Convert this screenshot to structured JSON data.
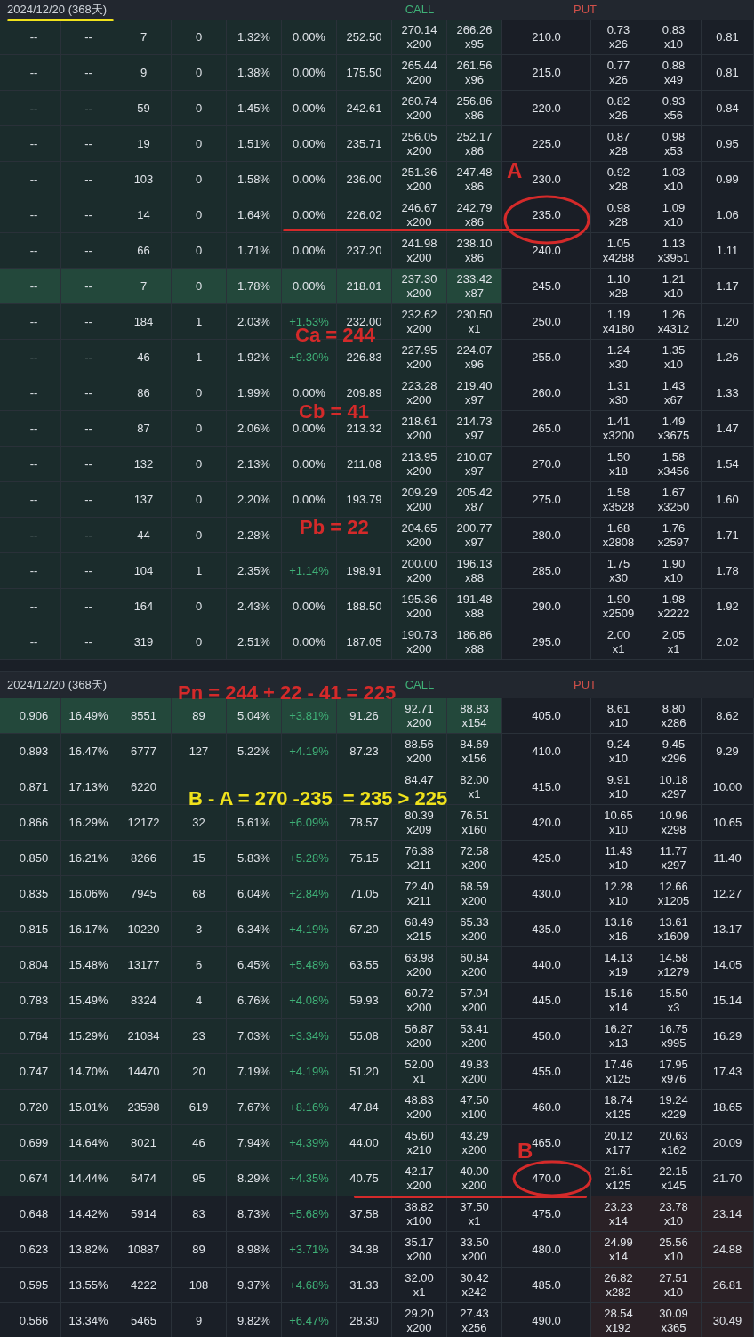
{
  "panels": [
    {
      "header": {
        "date": "2024/12/20 (368天)",
        "call_label": "CALL",
        "put_label": "PUT"
      },
      "rows": [
        {
          "strike": "210.0",
          "call": [
            "--",
            "--",
            "7",
            "0",
            "1.32%",
            "0.00%",
            "252.50"
          ],
          "change_up": false,
          "call_quotes": [
            [
              "270.14",
              "x200"
            ],
            [
              "266.26",
              "x95"
            ]
          ],
          "put_quotes": [
            [
              "0.73",
              "x26"
            ],
            [
              "0.83",
              "x10"
            ]
          ],
          "put_last": "0.81",
          "call_itm": true,
          "put_itm": false,
          "highlighted": false
        },
        {
          "strike": "215.0",
          "call": [
            "--",
            "--",
            "9",
            "0",
            "1.38%",
            "0.00%",
            "175.50"
          ],
          "change_up": false,
          "call_quotes": [
            [
              "265.44",
              "x200"
            ],
            [
              "261.56",
              "x96"
            ]
          ],
          "put_quotes": [
            [
              "0.77",
              "x26"
            ],
            [
              "0.88",
              "x49"
            ]
          ],
          "put_last": "0.81",
          "call_itm": true,
          "put_itm": false,
          "highlighted": false
        },
        {
          "strike": "220.0",
          "call": [
            "--",
            "--",
            "59",
            "0",
            "1.45%",
            "0.00%",
            "242.61"
          ],
          "change_up": false,
          "call_quotes": [
            [
              "260.74",
              "x200"
            ],
            [
              "256.86",
              "x86"
            ]
          ],
          "put_quotes": [
            [
              "0.82",
              "x26"
            ],
            [
              "0.93",
              "x56"
            ]
          ],
          "put_last": "0.84",
          "call_itm": true,
          "put_itm": false,
          "highlighted": false
        },
        {
          "strike": "225.0",
          "call": [
            "--",
            "--",
            "19",
            "0",
            "1.51%",
            "0.00%",
            "235.71"
          ],
          "change_up": false,
          "call_quotes": [
            [
              "256.05",
              "x200"
            ],
            [
              "252.17",
              "x86"
            ]
          ],
          "put_quotes": [
            [
              "0.87",
              "x28"
            ],
            [
              "0.98",
              "x53"
            ]
          ],
          "put_last": "0.95",
          "call_itm": true,
          "put_itm": false,
          "highlighted": false
        },
        {
          "strike": "230.0",
          "call": [
            "--",
            "--",
            "103",
            "0",
            "1.58%",
            "0.00%",
            "236.00"
          ],
          "change_up": false,
          "call_quotes": [
            [
              "251.36",
              "x200"
            ],
            [
              "247.48",
              "x86"
            ]
          ],
          "put_quotes": [
            [
              "0.92",
              "x28"
            ],
            [
              "1.03",
              "x10"
            ]
          ],
          "put_last": "0.99",
          "call_itm": true,
          "put_itm": false,
          "highlighted": false
        },
        {
          "strike": "235.0",
          "call": [
            "--",
            "--",
            "14",
            "0",
            "1.64%",
            "0.00%",
            "226.02"
          ],
          "change_up": false,
          "call_quotes": [
            [
              "246.67",
              "x200"
            ],
            [
              "242.79",
              "x86"
            ]
          ],
          "put_quotes": [
            [
              "0.98",
              "x28"
            ],
            [
              "1.09",
              "x10"
            ]
          ],
          "put_last": "1.06",
          "call_itm": true,
          "put_itm": false,
          "highlighted": false
        },
        {
          "strike": "240.0",
          "call": [
            "--",
            "--",
            "66",
            "0",
            "1.71%",
            "0.00%",
            "237.20"
          ],
          "change_up": false,
          "call_quotes": [
            [
              "241.98",
              "x200"
            ],
            [
              "238.10",
              "x86"
            ]
          ],
          "put_quotes": [
            [
              "1.05",
              "x4288"
            ],
            [
              "1.13",
              "x3951"
            ]
          ],
          "put_last": "1.11",
          "call_itm": true,
          "put_itm": false,
          "highlighted": false
        },
        {
          "strike": "245.0",
          "call": [
            "--",
            "--",
            "7",
            "0",
            "1.78%",
            "0.00%",
            "218.01"
          ],
          "change_up": false,
          "call_quotes": [
            [
              "237.30",
              "x200"
            ],
            [
              "233.42",
              "x87"
            ]
          ],
          "put_quotes": [
            [
              "1.10",
              "x28"
            ],
            [
              "1.21",
              "x10"
            ]
          ],
          "put_last": "1.17",
          "call_itm": true,
          "put_itm": false,
          "highlighted": true
        },
        {
          "strike": "250.0",
          "call": [
            "--",
            "--",
            "184",
            "1",
            "2.03%",
            "+1.53%",
            "232.00"
          ],
          "change_up": true,
          "call_quotes": [
            [
              "232.62",
              "x200"
            ],
            [
              "230.50",
              "x1"
            ]
          ],
          "put_quotes": [
            [
              "1.19",
              "x4180"
            ],
            [
              "1.26",
              "x4312"
            ]
          ],
          "put_last": "1.20",
          "call_itm": true,
          "put_itm": false,
          "highlighted": false
        },
        {
          "strike": "255.0",
          "call": [
            "--",
            "--",
            "46",
            "1",
            "1.92%",
            "+9.30%",
            "226.83"
          ],
          "change_up": true,
          "call_quotes": [
            [
              "227.95",
              "x200"
            ],
            [
              "224.07",
              "x96"
            ]
          ],
          "put_quotes": [
            [
              "1.24",
              "x30"
            ],
            [
              "1.35",
              "x10"
            ]
          ],
          "put_last": "1.26",
          "call_itm": true,
          "put_itm": false,
          "highlighted": false
        },
        {
          "strike": "260.0",
          "call": [
            "--",
            "--",
            "86",
            "0",
            "1.99%",
            "0.00%",
            "209.89"
          ],
          "change_up": false,
          "call_quotes": [
            [
              "223.28",
              "x200"
            ],
            [
              "219.40",
              "x97"
            ]
          ],
          "put_quotes": [
            [
              "1.31",
              "x30"
            ],
            [
              "1.43",
              "x67"
            ]
          ],
          "put_last": "1.33",
          "call_itm": true,
          "put_itm": false,
          "highlighted": false
        },
        {
          "strike": "265.0",
          "call": [
            "--",
            "--",
            "87",
            "0",
            "2.06%",
            "0.00%",
            "213.32"
          ],
          "change_up": false,
          "call_quotes": [
            [
              "218.61",
              "x200"
            ],
            [
              "214.73",
              "x97"
            ]
          ],
          "put_quotes": [
            [
              "1.41",
              "x3200"
            ],
            [
              "1.49",
              "x3675"
            ]
          ],
          "put_last": "1.47",
          "call_itm": true,
          "put_itm": false,
          "highlighted": false
        },
        {
          "strike": "270.0",
          "call": [
            "--",
            "--",
            "132",
            "0",
            "2.13%",
            "0.00%",
            "211.08"
          ],
          "change_up": false,
          "call_quotes": [
            [
              "213.95",
              "x200"
            ],
            [
              "210.07",
              "x97"
            ]
          ],
          "put_quotes": [
            [
              "1.50",
              "x18"
            ],
            [
              "1.58",
              "x3456"
            ]
          ],
          "put_last": "1.54",
          "call_itm": true,
          "put_itm": false,
          "highlighted": false
        },
        {
          "strike": "275.0",
          "call": [
            "--",
            "--",
            "137",
            "0",
            "2.20%",
            "0.00%",
            "193.79"
          ],
          "change_up": false,
          "call_quotes": [
            [
              "209.29",
              "x200"
            ],
            [
              "205.42",
              "x87"
            ]
          ],
          "put_quotes": [
            [
              "1.58",
              "x3528"
            ],
            [
              "1.67",
              "x3250"
            ]
          ],
          "put_last": "1.60",
          "call_itm": true,
          "put_itm": false,
          "highlighted": false
        },
        {
          "strike": "280.0",
          "call": [
            "--",
            "--",
            "44",
            "0",
            "2.28%"
          ],
          "call_quotes": [
            [
              "204.65",
              "x200"
            ],
            [
              "200.77",
              "x97"
            ]
          ],
          "put_quotes": [
            [
              "1.68",
              "x2808"
            ],
            [
              "1.76",
              "x2597"
            ]
          ],
          "put_last": "1.71",
          "call_itm": true,
          "put_itm": false,
          "highlighted": false
        },
        {
          "strike": "285.0",
          "call": [
            "--",
            "--",
            "104",
            "1",
            "2.35%",
            "+1.14%",
            "198.91"
          ],
          "change_up": true,
          "call_quotes": [
            [
              "200.00",
              "x200"
            ],
            [
              "196.13",
              "x88"
            ]
          ],
          "put_quotes": [
            [
              "1.75",
              "x30"
            ],
            [
              "1.90",
              "x10"
            ]
          ],
          "put_last": "1.78",
          "call_itm": true,
          "put_itm": false,
          "highlighted": false
        },
        {
          "strike": "290.0",
          "call": [
            "--",
            "--",
            "164",
            "0",
            "2.43%",
            "0.00%",
            "188.50"
          ],
          "change_up": false,
          "call_quotes": [
            [
              "195.36",
              "x200"
            ],
            [
              "191.48",
              "x88"
            ]
          ],
          "put_quotes": [
            [
              "1.90",
              "x2509"
            ],
            [
              "1.98",
              "x2222"
            ]
          ],
          "put_last": "1.92",
          "call_itm": true,
          "put_itm": false,
          "highlighted": false
        },
        {
          "strike": "295.0",
          "call": [
            "--",
            "--",
            "319",
            "0",
            "2.51%",
            "0.00%",
            "187.05"
          ],
          "change_up": false,
          "call_quotes": [
            [
              "190.73",
              "x200"
            ],
            [
              "186.86",
              "x88"
            ]
          ],
          "put_quotes": [
            [
              "2.00",
              "x1"
            ],
            [
              "2.05",
              "x1"
            ]
          ],
          "put_last": "2.02",
          "call_itm": true,
          "put_itm": false,
          "highlighted": false
        }
      ]
    },
    {
      "header": {
        "date": "2024/12/20 (368天)",
        "call_label": "CALL",
        "put_label": "PUT"
      },
      "rows": [
        {
          "strike": "405.0",
          "call": [
            "0.906",
            "16.49%",
            "8551",
            "89",
            "5.04%",
            "+3.81%",
            "91.26"
          ],
          "change_up": true,
          "call_quotes": [
            [
              "92.71",
              "x200"
            ],
            [
              "88.83",
              "x154"
            ]
          ],
          "put_quotes": [
            [
              "8.61",
              "x10"
            ],
            [
              "8.80",
              "x286"
            ]
          ],
          "put_last": "8.62",
          "call_itm": true,
          "put_itm": false,
          "highlighted": true
        },
        {
          "strike": "410.0",
          "call": [
            "0.893",
            "16.47%",
            "6777",
            "127",
            "5.22%",
            "+4.19%",
            "87.23"
          ],
          "change_up": true,
          "call_quotes": [
            [
              "88.56",
              "x200"
            ],
            [
              "84.69",
              "x156"
            ]
          ],
          "put_quotes": [
            [
              "9.24",
              "x10"
            ],
            [
              "9.45",
              "x296"
            ]
          ],
          "put_last": "9.29",
          "call_itm": true,
          "put_itm": false,
          "highlighted": false
        },
        {
          "strike": "415.0",
          "call": [
            "0.871",
            "17.13%",
            "6220"
          ],
          "call_quotes": [
            [
              "84.47"
            ],
            [
              "82.00",
              "x1"
            ]
          ],
          "put_quotes": [
            [
              "9.91",
              "x10"
            ],
            [
              "10.18",
              "x297"
            ]
          ],
          "put_last": "10.00",
          "call_itm": true,
          "put_itm": false,
          "highlighted": false
        },
        {
          "strike": "420.0",
          "call": [
            "0.866",
            "16.29%",
            "12172",
            "32",
            "5.61%",
            "+6.09%",
            "78.57"
          ],
          "change_up": true,
          "call_quotes": [
            [
              "80.39",
              "x209"
            ],
            [
              "76.51",
              "x160"
            ]
          ],
          "put_quotes": [
            [
              "10.65",
              "x10"
            ],
            [
              "10.96",
              "x298"
            ]
          ],
          "put_last": "10.65",
          "call_itm": true,
          "put_itm": false,
          "highlighted": false
        },
        {
          "strike": "425.0",
          "call": [
            "0.850",
            "16.21%",
            "8266",
            "15",
            "5.83%",
            "+5.28%",
            "75.15"
          ],
          "change_up": true,
          "call_quotes": [
            [
              "76.38",
              "x211"
            ],
            [
              "72.58",
              "x200"
            ]
          ],
          "put_quotes": [
            [
              "11.43",
              "x10"
            ],
            [
              "11.77",
              "x297"
            ]
          ],
          "put_last": "11.40",
          "call_itm": true,
          "put_itm": false,
          "highlighted": false
        },
        {
          "strike": "430.0",
          "call": [
            "0.835",
            "16.06%",
            "7945",
            "68",
            "6.04%",
            "+2.84%",
            "71.05"
          ],
          "change_up": true,
          "call_quotes": [
            [
              "72.40",
              "x211"
            ],
            [
              "68.59",
              "x200"
            ]
          ],
          "put_quotes": [
            [
              "12.28",
              "x10"
            ],
            [
              "12.66",
              "x1205"
            ]
          ],
          "put_last": "12.27",
          "call_itm": true,
          "put_itm": false,
          "highlighted": false
        },
        {
          "strike": "435.0",
          "call": [
            "0.815",
            "16.17%",
            "10220",
            "3",
            "6.34%",
            "+4.19%",
            "67.20"
          ],
          "change_up": true,
          "call_quotes": [
            [
              "68.49",
              "x215"
            ],
            [
              "65.33",
              "x200"
            ]
          ],
          "put_quotes": [
            [
              "13.16",
              "x16"
            ],
            [
              "13.61",
              "x1609"
            ]
          ],
          "put_last": "13.17",
          "call_itm": true,
          "put_itm": false,
          "highlighted": false
        },
        {
          "strike": "440.0",
          "call": [
            "0.804",
            "15.48%",
            "13177",
            "6",
            "6.45%",
            "+5.48%",
            "63.55"
          ],
          "change_up": true,
          "call_quotes": [
            [
              "63.98",
              "x200"
            ],
            [
              "60.84",
              "x200"
            ]
          ],
          "put_quotes": [
            [
              "14.13",
              "x19"
            ],
            [
              "14.58",
              "x1279"
            ]
          ],
          "put_last": "14.05",
          "call_itm": true,
          "put_itm": false,
          "highlighted": false
        },
        {
          "strike": "445.0",
          "call": [
            "0.783",
            "15.49%",
            "8324",
            "4",
            "6.76%",
            "+4.08%",
            "59.93"
          ],
          "change_up": true,
          "call_quotes": [
            [
              "60.72",
              "x200"
            ],
            [
              "57.04",
              "x200"
            ]
          ],
          "put_quotes": [
            [
              "15.16",
              "x14"
            ],
            [
              "15.50",
              "x3"
            ]
          ],
          "put_last": "15.14",
          "call_itm": true,
          "put_itm": false,
          "highlighted": false
        },
        {
          "strike": "450.0",
          "call": [
            "0.764",
            "15.29%",
            "21084",
            "23",
            "7.03%",
            "+3.34%",
            "55.08"
          ],
          "change_up": true,
          "call_quotes": [
            [
              "56.87",
              "x200"
            ],
            [
              "53.41",
              "x200"
            ]
          ],
          "put_quotes": [
            [
              "16.27",
              "x13"
            ],
            [
              "16.75",
              "x995"
            ]
          ],
          "put_last": "16.29",
          "call_itm": true,
          "put_itm": false,
          "highlighted": false
        },
        {
          "strike": "455.0",
          "call": [
            "0.747",
            "14.70%",
            "14470",
            "20",
            "7.19%",
            "+4.19%",
            "51.20"
          ],
          "change_up": true,
          "call_quotes": [
            [
              "52.00",
              "x1"
            ],
            [
              "49.83",
              "x200"
            ]
          ],
          "put_quotes": [
            [
              "17.46",
              "x125"
            ],
            [
              "17.95",
              "x976"
            ]
          ],
          "put_last": "17.43",
          "call_itm": true,
          "put_itm": false,
          "highlighted": false
        },
        {
          "strike": "460.0",
          "call": [
            "0.720",
            "15.01%",
            "23598",
            "619",
            "7.67%",
            "+8.16%",
            "47.84"
          ],
          "change_up": true,
          "call_quotes": [
            [
              "48.83",
              "x200"
            ],
            [
              "47.50",
              "x100"
            ]
          ],
          "put_quotes": [
            [
              "18.74",
              "x125"
            ],
            [
              "19.24",
              "x229"
            ]
          ],
          "put_last": "18.65",
          "call_itm": true,
          "put_itm": false,
          "highlighted": false
        },
        {
          "strike": "465.0",
          "call": [
            "0.699",
            "14.64%",
            "8021",
            "46",
            "7.94%",
            "+4.39%",
            "44.00"
          ],
          "change_up": true,
          "call_quotes": [
            [
              "45.60",
              "x210"
            ],
            [
              "43.29",
              "x200"
            ]
          ],
          "put_quotes": [
            [
              "20.12",
              "x177"
            ],
            [
              "20.63",
              "x162"
            ]
          ],
          "put_last": "20.09",
          "call_itm": true,
          "put_itm": false,
          "highlighted": false
        },
        {
          "strike": "470.0",
          "call": [
            "0.674",
            "14.44%",
            "6474",
            "95",
            "8.29%",
            "+4.35%",
            "40.75"
          ],
          "change_up": true,
          "call_quotes": [
            [
              "42.17",
              "x200"
            ],
            [
              "40.00",
              "x200"
            ]
          ],
          "put_quotes": [
            [
              "21.61",
              "x125"
            ],
            [
              "22.15",
              "x145"
            ]
          ],
          "put_last": "21.70",
          "call_itm": true,
          "put_itm": false,
          "highlighted": false
        },
        {
          "strike": "475.0",
          "call": [
            "0.648",
            "14.42%",
            "5914",
            "83",
            "8.73%",
            "+5.68%",
            "37.58"
          ],
          "change_up": true,
          "call_quotes": [
            [
              "38.82",
              "x100"
            ],
            [
              "37.50",
              "x1"
            ]
          ],
          "put_quotes": [
            [
              "23.23",
              "x14"
            ],
            [
              "23.78",
              "x10"
            ]
          ],
          "put_last": "23.14",
          "call_itm": false,
          "put_itm": true,
          "highlighted": false
        },
        {
          "strike": "480.0",
          "call": [
            "0.623",
            "13.82%",
            "10887",
            "89",
            "8.98%",
            "+3.71%",
            "34.38"
          ],
          "change_up": true,
          "call_quotes": [
            [
              "35.17",
              "x200"
            ],
            [
              "33.50",
              "x200"
            ]
          ],
          "put_quotes": [
            [
              "24.99",
              "x14"
            ],
            [
              "25.56",
              "x10"
            ]
          ],
          "put_last": "24.88",
          "call_itm": false,
          "put_itm": true,
          "highlighted": false
        },
        {
          "strike": "485.0",
          "call": [
            "0.595",
            "13.55%",
            "4222",
            "108",
            "9.37%",
            "+4.68%",
            "31.33"
          ],
          "change_up": true,
          "call_quotes": [
            [
              "32.00",
              "x1"
            ],
            [
              "30.42",
              "x242"
            ]
          ],
          "put_quotes": [
            [
              "26.82",
              "x282"
            ],
            [
              "27.51",
              "x10"
            ]
          ],
          "put_last": "26.81",
          "call_itm": false,
          "put_itm": true,
          "highlighted": false
        },
        {
          "strike": "490.0",
          "call": [
            "0.566",
            "13.34%",
            "5465",
            "9",
            "9.82%",
            "+6.47%",
            "28.30"
          ],
          "change_up": true,
          "call_quotes": [
            [
              "29.20",
              "x200"
            ],
            [
              "27.43",
              "x256"
            ]
          ],
          "put_quotes": [
            [
              "28.54",
              "x192"
            ],
            [
              "30.09",
              "x365"
            ]
          ],
          "put_last": "30.49",
          "call_itm": false,
          "put_itm": true,
          "highlighted": false
        }
      ]
    }
  ],
  "annotations": [
    {
      "text": "A",
      "color": "#d42a2a"
    },
    {
      "text": "Ca = 244",
      "color": "#d42a2a"
    },
    {
      "text": "Cb = 41",
      "color": "#d42a2a"
    },
    {
      "text": "Pb = 22",
      "color": "#d42a2a"
    },
    {
      "text": "Pn = 244 + 22 - 41 = 225",
      "color": "#d42a2a"
    },
    {
      "text": "B - A = 270 -235  = 235 > 225",
      "color": "#f0e21c"
    },
    {
      "text": "B",
      "color": "#d42a2a"
    }
  ]
}
